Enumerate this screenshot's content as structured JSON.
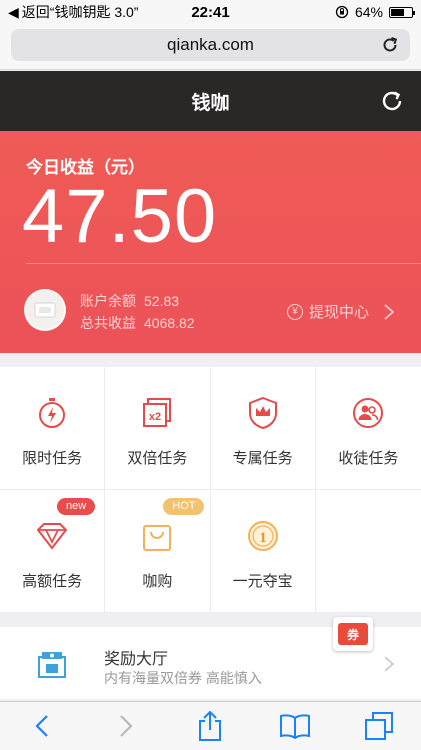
{
  "status_bar": {
    "back_label": "返回“钱咖钥匙 3.0”",
    "time": "22:41",
    "battery": "64%",
    "battery_level": 0.64
  },
  "browser": {
    "url": "qianka.com"
  },
  "header": {
    "title": "钱咖"
  },
  "earnings": {
    "title": "今日收益（元）",
    "amount": "47.50",
    "balance_label": "账户余额",
    "balance_value": "52.83",
    "total_label": "总共收益",
    "total_value": "4068.82",
    "withdraw_label": "提现中心"
  },
  "tasks": [
    {
      "label": "限时任务",
      "icon": "stopwatch-icon"
    },
    {
      "label": "双倍任务",
      "icon": "x2-cards-icon"
    },
    {
      "label": "专属任务",
      "icon": "crown-shield-icon"
    },
    {
      "label": "收徒任务",
      "icon": "apprentice-icon"
    },
    {
      "label": "高额任务",
      "icon": "diamond-icon",
      "badge": "new"
    },
    {
      "label": "咖购",
      "icon": "shopping-bag-icon",
      "badge": "HOT"
    },
    {
      "label": "一元夺宝",
      "icon": "coin-1-icon"
    },
    {
      "label": "",
      "icon": ""
    }
  ],
  "reward_hall": {
    "title": "奖励大厅",
    "subtitle": "内有海量双倍券 高能慎入",
    "coupon_label": "券"
  },
  "colors": {
    "accent": "#ec5258",
    "header_bg": "#2a2727",
    "ios_blue": "#1a82fb",
    "hot": "#f2c26f"
  }
}
